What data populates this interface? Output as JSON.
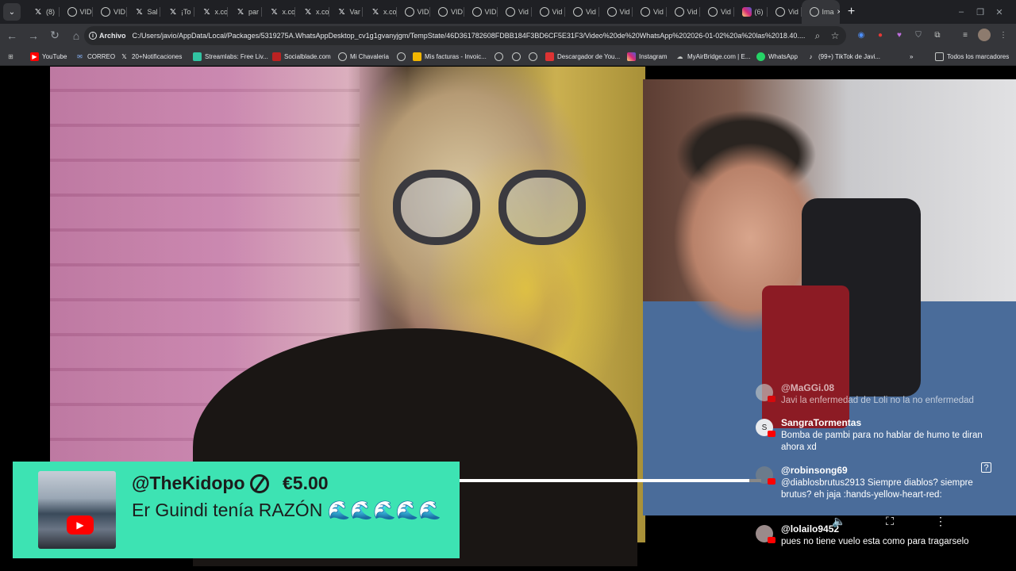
{
  "browser": {
    "tabs": [
      {
        "icon": "x-icon",
        "label": "(8)"
      },
      {
        "icon": "globe-icon",
        "label": "VID"
      },
      {
        "icon": "globe-icon",
        "label": "VID"
      },
      {
        "icon": "x-icon",
        "label": "Sal"
      },
      {
        "icon": "x-icon",
        "label": "¡To"
      },
      {
        "icon": "x-icon",
        "label": "x.co"
      },
      {
        "icon": "x-icon",
        "label": "par"
      },
      {
        "icon": "x-icon",
        "label": "x.co"
      },
      {
        "icon": "x-icon",
        "label": "x.co"
      },
      {
        "icon": "x-icon",
        "label": "Var"
      },
      {
        "icon": "x-icon",
        "label": "x.co"
      },
      {
        "icon": "globe-icon",
        "label": "VID"
      },
      {
        "icon": "globe-icon",
        "label": "VID"
      },
      {
        "icon": "globe-icon",
        "label": "VID"
      },
      {
        "icon": "globe-icon",
        "label": "Vid"
      },
      {
        "icon": "globe-icon",
        "label": "Vid"
      },
      {
        "icon": "globe-icon",
        "label": "Vid"
      },
      {
        "icon": "globe-icon",
        "label": "Vid"
      },
      {
        "icon": "globe-icon",
        "label": "Vid"
      },
      {
        "icon": "globe-icon",
        "label": "Vid"
      },
      {
        "icon": "globe-icon",
        "label": "Vid"
      },
      {
        "icon": "instagram-icon",
        "label": "(6)"
      },
      {
        "icon": "globe-icon",
        "label": "Vid"
      },
      {
        "icon": "globe-icon",
        "label": "Ima"
      }
    ],
    "active_tab_close": "×",
    "new_tab": "+",
    "window_controls": {
      "minimize": "–",
      "maximize": "❐",
      "close": "✕"
    },
    "address": {
      "chip_label": "Archivo",
      "url": "C:/Users/javio/AppData/Local/Packages/5319275A.WhatsAppDesktop_cv1g1gvanyjgm/TempState/46D361782608FDBB184F3BD6CF5E31F3/Video%20de%20WhatsApp%202026-01-02%20a%20las%2018.40...."
    },
    "bookmarks": [
      {
        "icon": "youtube-icon",
        "label": "YouTube"
      },
      {
        "icon": "mail-icon",
        "label": "CORREO"
      },
      {
        "icon": "x-icon",
        "label": "20+Notificaciones"
      },
      {
        "icon": "streamlabs-icon",
        "label": "Streamlabs: Free Liv..."
      },
      {
        "icon": "socialblade-icon",
        "label": "Socialblade.com"
      },
      {
        "icon": "globe-icon",
        "label": "Mi Chavaleria"
      },
      {
        "icon": "globe-icon",
        "label": ""
      },
      {
        "icon": "invoice-icon",
        "label": "Mis facturas - Invoic..."
      },
      {
        "icon": "globe-icon",
        "label": ""
      },
      {
        "icon": "globe-icon",
        "label": ""
      },
      {
        "icon": "globe-icon",
        "label": ""
      },
      {
        "icon": "download-icon",
        "label": "Descargador de You..."
      },
      {
        "icon": "instagram-icon",
        "label": "Instagram"
      },
      {
        "icon": "cloud-icon",
        "label": "MyAirBridge.com | E..."
      },
      {
        "icon": "whatsapp-icon",
        "label": "WhatsApp"
      },
      {
        "icon": "tiktok-icon",
        "label": "(99+) TikTok de Javi..."
      }
    ],
    "bookmarks_more": "»",
    "all_bookmarks_label": "Todos los marcadores"
  },
  "chat": [
    {
      "author": "@MaGGi.08",
      "text": "Javi la enfermedad de Loli no la no enfermedad",
      "avatar": ""
    },
    {
      "author": "SangraTormentas",
      "text": "Bomba de pambi para no hablar de humo te diran ahora xd",
      "avatar": "S"
    },
    {
      "author": "@robinsong69",
      "text": "@diablosbrutus2913 Siempre diablos? siempre brutus? eh jaja :hands-yellow-heart-red:",
      "avatar": ""
    },
    {
      "author": "@lolailo9452",
      "text": "pues no tiene vuelo esta como para tragarselo",
      "avatar": ""
    }
  ],
  "donation": {
    "user": "@TheKidopo",
    "amount": "€5.00",
    "message": "Er Guindi tenía RAZÓN 🌊🌊🌊🌊🌊",
    "color": "#3de3b3"
  },
  "player": {
    "progress": 0.96
  }
}
